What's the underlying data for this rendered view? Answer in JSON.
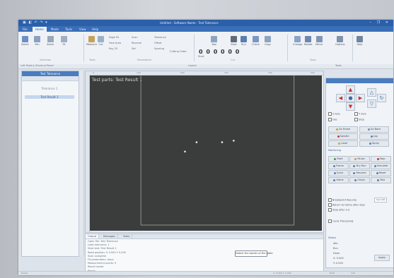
{
  "window": {
    "title": "Untitled - Software Name - Test Tolerance",
    "quick_access": "▣ ◧ ↶ ↷ ▾",
    "controls": "– ❐ ✕"
  },
  "tabs": [
    "File",
    "Home",
    "Mode",
    "Tools",
    "View",
    "Help"
  ],
  "ribbon": {
    "big_buttons": [
      {
        "label": "Select",
        "color": "#6c8fc6"
      },
      {
        "label": "Pan",
        "color": "#8aa0c0"
      },
      {
        "label": "Zoom",
        "color": "#9aa8b8"
      },
      {
        "label": "Fit",
        "color": "#a0b0c2"
      },
      {
        "label": "Measure",
        "color": "#c5a25a"
      },
      {
        "label": "Cut",
        "color": "#9cb0c8"
      },
      {
        "label": "Tool",
        "color": "#8fa4bf"
      },
      {
        "label": "Start",
        "color": "#606a78"
      },
      {
        "label": "Run",
        "color": "#5b7db0"
      },
      {
        "label": "Check",
        "color": "#7a97c2"
      },
      {
        "label": "Copy",
        "color": "#8fa4bf"
      },
      {
        "label": "Change",
        "color": "#8aa3c6"
      },
      {
        "label": "Rotate",
        "color": "#6e87ad"
      },
      {
        "label": "Mirror",
        "color": "#8196b6"
      },
      {
        "label": "Options",
        "color": "#8193ab"
      },
      {
        "label": "Help",
        "color": "#72849e"
      }
    ],
    "small_items": [
      "Edge Fit",
      "Face Area",
      "Ray 20",
      "Scan",
      "Reverse",
      "Set",
      "Tolerance",
      "Offset",
      "Spacing",
      "Cutting Order"
    ],
    "groups": [
      "Selection",
      "Tools",
      "Parameters",
      "Cut",
      "Tools"
    ],
    "digits": "0 0 0 0 0 0",
    "start_label": "Start"
  },
  "subbar": {
    "left": "Left Panel ▸ Shortcut Panel",
    "middle": "Layout",
    "right": "Tools"
  },
  "left_panel": {
    "header": "Test Tolerance",
    "items": [
      {
        "label": "Tolerance 1",
        "selected": false
      },
      {
        "label": "Test Result 1",
        "selected": true
      }
    ]
  },
  "plot": {
    "title": "Test parts: Test Result 1",
    "ruler": [
      "0",
      "100",
      "200",
      "300",
      "400",
      "500"
    ]
  },
  "right_panel": {
    "options": [
      "Z Axis",
      "Y Axis",
      "Use",
      "Step"
    ],
    "buttons_a": [
      {
        "label": "Go Home",
        "dot": "#c9a03a"
      },
      {
        "label": "Go Back",
        "dot": "#6a8cc0"
      },
      {
        "label": "Spindle",
        "dot": "#c23b3b"
      },
      {
        "label": "Jog",
        "dot": "#5c7fb5"
      },
      {
        "label": "Laser",
        "dot": "#d1a33a"
      },
      {
        "label": "Spray",
        "dot": "#5c7fb5"
      }
    ],
    "section": "Machining",
    "buttons_b": [
      {
        "label": "Start",
        "dot": "#3f9a4c"
      },
      {
        "label": "Pause",
        "dot": "#c9a03a"
      },
      {
        "label": "Stop",
        "dot": "#c23b3b"
      },
      {
        "label": "Frame",
        "dot": "#5c7fb5"
      },
      {
        "label": "Dry Run",
        "dot": "#5c7fb5"
      },
      {
        "label": "Simulate",
        "dot": "#5c7fb5"
      },
      {
        "label": "Cycle",
        "dot": "#5c7fb5"
      },
      {
        "label": "Resume",
        "dot": "#5c7fb5"
      },
      {
        "label": "Reset",
        "dot": "#5c7fb5"
      },
      {
        "label": "Home",
        "dot": "#5c7fb5"
      },
      {
        "label": "Origin",
        "dot": "#5c7fb5"
      },
      {
        "label": "Test",
        "dot": "#5c7fb5"
      }
    ],
    "checks": [
      "Breakpoint Resume",
      "Return to Home after stop",
      "Stop after cut",
      "Cycle Processing"
    ],
    "speed_label": "Spd",
    "speed_value": "100",
    "status_title": "Status",
    "status_lines": [
      "Idle",
      "Run",
      "Done",
      "X: 0.000",
      "Y: 0.000"
    ],
    "apply_label": "Apply"
  },
  "bottom": {
    "tabs": [
      "Output",
      "Messages",
      "Tasks"
    ],
    "logs": [
      "Open file: Test Tolerance",
      "Load tolerance: 1",
      "Start test: Test Result 1",
      "Read position: X 0.000 Y 0.000",
      "Scan complete",
      "Fit parameters: done",
      "Measurement points: 5",
      "Result saved",
      "Ready"
    ]
  },
  "tooltip": "Detect the border of the table",
  "taskbar": [
    "Ready",
    "X: 0.000 Y: 0.000",
    "NUM",
    "CAP"
  ],
  "chart_data": {
    "type": "scatter",
    "title": "Test parts: Test Result 1",
    "points": [
      {
        "x": 0.41,
        "y": 0.49
      },
      {
        "x": 0.46,
        "y": 0.43
      },
      {
        "x": 0.57,
        "y": 0.43
      },
      {
        "x": 0.62,
        "y": 0.42
      }
    ],
    "frame": {
      "x0": 0.22,
      "x1": 0.88,
      "y0": 0.0,
      "y1": 1.0
    },
    "xlim": [
      0,
      1
    ],
    "ylim": [
      0,
      1
    ],
    "grid": false
  }
}
